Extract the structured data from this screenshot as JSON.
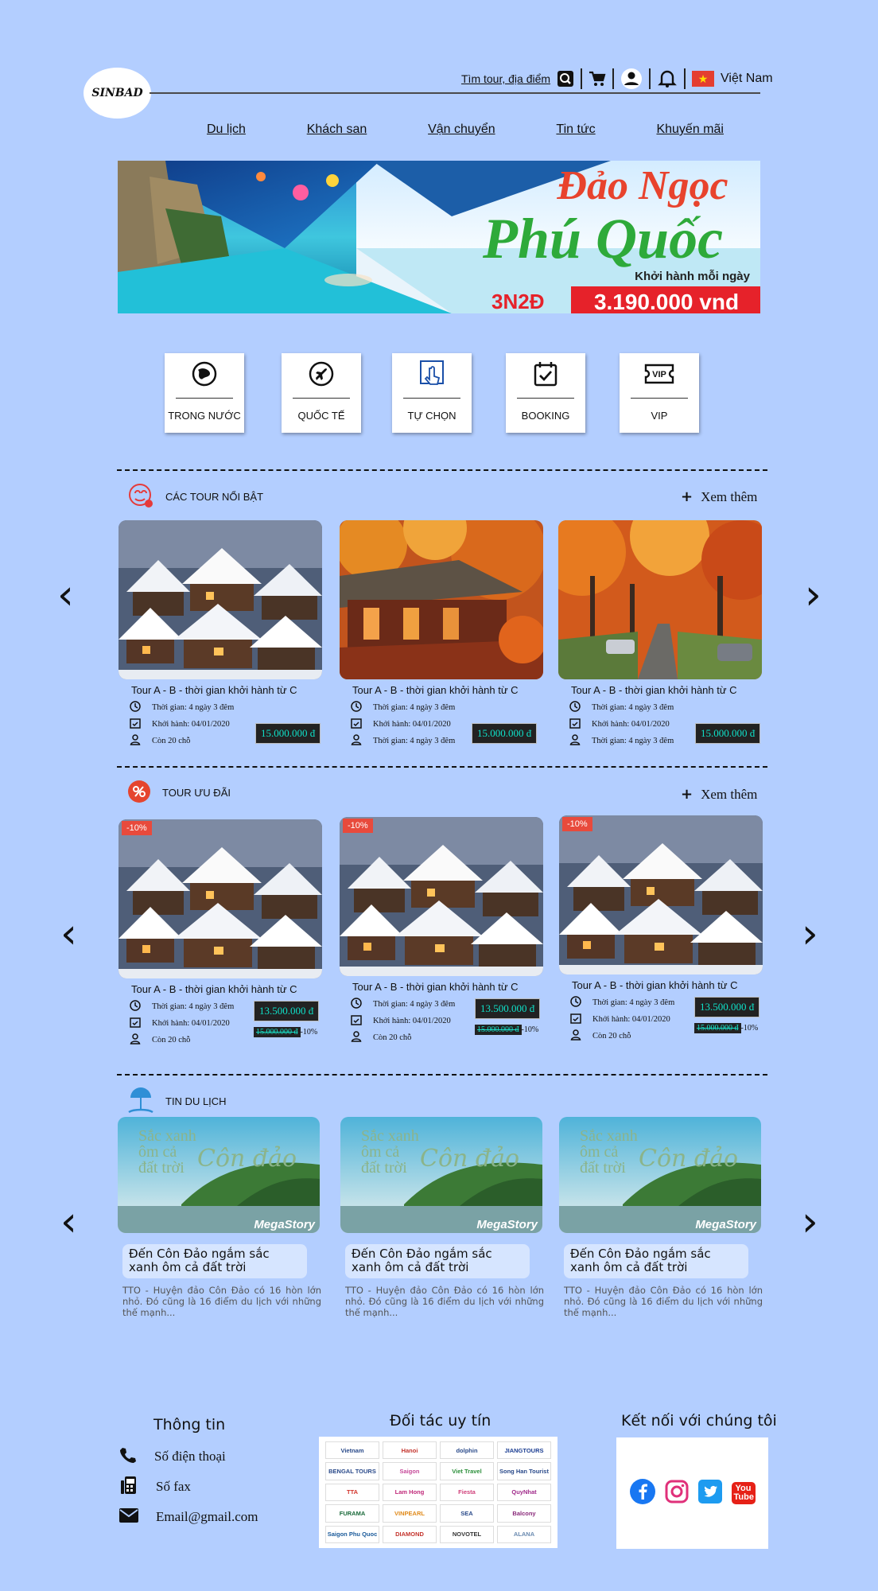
{
  "header": {
    "logo_text": "SINBAD",
    "search_label": "Tìm tour, địa điểm",
    "language": "Việt Nam"
  },
  "nav": [
    "Du lịch",
    "Khách san",
    "Vận chuyển",
    "Tin tức",
    "Khuyến mãi"
  ],
  "banner": {
    "line1": "Đảo Ngọc",
    "line2": "Phú Quốc",
    "tagline": "Khởi hành mỗi ngày",
    "duration": "3N2Đ",
    "price": "3.190.000 vnd"
  },
  "categories": [
    "TRONG NƯỚC",
    "QUỐC TẾ",
    "TỰ CHỌN",
    "BOOKING",
    "VIP"
  ],
  "vip_icon_text": "VIP",
  "featured": {
    "title": "CÁC TOUR NỔI BẬT",
    "more": "Xem thêm",
    "items": [
      {
        "title": "Tour A - B - thời gian khởi hành từ C",
        "time": "Thời gian: 4 ngày 3 đêm",
        "depart": "Khởi hành: 04/01/2020",
        "seats": "Còn 20 chỗ",
        "price": "15.000.000 đ"
      },
      {
        "title": "Tour A - B - thời gian khởi hành từ C",
        "time": "Thời gian: 4 ngày 3 đêm",
        "depart": "Khởi hành: 04/01/2020",
        "seats": "Thời gian: 4 ngày 3 đêm",
        "price": "15.000.000 đ"
      },
      {
        "title": "Tour A - B - thời gian khởi hành từ C",
        "time": "Thời gian: 4 ngày 3 đêm",
        "depart": "Khởi hành: 04/01/2020",
        "seats": "Thời gian: 4 ngày 3 đêm",
        "price": "15.000.000 đ"
      }
    ]
  },
  "deals": {
    "title": "TOUR ƯU ĐÃI",
    "more": "Xem thêm",
    "items": [
      {
        "badge": "-10%",
        "title": "Tour A - B - thời gian khởi hành từ C",
        "time": "Thời gian: 4 ngày 3 đêm",
        "depart": "Khởi hành: 04/01/2020",
        "seats": "Còn 20 chỗ",
        "price": "13.500.000 đ",
        "old_price": "15.000.000 đ",
        "discount": "-10%"
      },
      {
        "badge": "-10%",
        "title": "Tour A - B - thời gian khởi hành từ C",
        "time": "Thời gian: 4 ngày 3 đêm",
        "depart": "Khởi hành: 04/01/2020",
        "seats": "Còn 20 chỗ",
        "price": "13.500.000 đ",
        "old_price": "15.000.000 đ",
        "discount": "-10%"
      },
      {
        "badge": "-10%",
        "title": "Tour A - B - thời gian khởi hành từ C",
        "time": "Thời gian: 4 ngày 3 đêm",
        "depart": "Khởi hành: 04/01/2020",
        "seats": "Còn 20 chỗ",
        "price": "13.500.000 đ",
        "old_price": "15.000.000 đ",
        "discount": "-10%"
      }
    ]
  },
  "news": {
    "title": "TIN DU LỊCH",
    "image_text1": "Sắc xanh",
    "image_text2": "ôm cả",
    "image_text3": "đất trời",
    "image_script": "Côn đảo",
    "image_brand": "MegaStory",
    "items": [
      {
        "title": "Đến Côn Đảo ngắm sắc xanh ôm cả đất trời",
        "desc": "TTO - Huyện đảo Côn Đảo có 16 hòn lớn nhỏ. Đó cũng là 16 điểm du lịch với những thế mạnh..."
      },
      {
        "title": "Đến Côn Đảo ngắm sắc xanh ôm cả đất trời",
        "desc": "TTO - Huyện đảo Côn Đảo có 16 hòn lớn nhỏ. Đó cũng là 16 điểm du lịch với những thế mạnh..."
      },
      {
        "title": "Đến Côn Đảo ngắm sắc xanh ôm cả đất trời",
        "desc": "TTO - Huyện đảo Côn Đảo có 16 hòn lớn nhỏ. Đó cũng là 16 điểm du lịch với những thế mạnh..."
      }
    ]
  },
  "footer": {
    "info_title": "Thông tin",
    "phone": "Số điện thoại",
    "fax": "Số fax",
    "email": "Email@gmail.com",
    "partners_title": "Đối tác uy tín",
    "partners": [
      "Vietnam",
      "Hanoi",
      "dolphin",
      "JIANGTOURS",
      "BENGAL TOURS",
      "Saigon",
      "Viet Travel",
      "Song Han Tourist",
      "TTA",
      "Lam Hong",
      "Fiesta",
      "QuyNhat",
      "FURAMA",
      "VINPEARL",
      "SEA",
      "Balcony",
      "Saigon Phu Quoc",
      "DIAMOND",
      "NOVOTEL",
      "ALANA"
    ],
    "connect_title": "Kết nối với chúng tôi",
    "youtube_label": "You Tube"
  },
  "colors": {
    "background": "#b3ceff",
    "price_bg": "#222222",
    "price_text": "#0fe0c8",
    "badge": "#e84a3c"
  }
}
